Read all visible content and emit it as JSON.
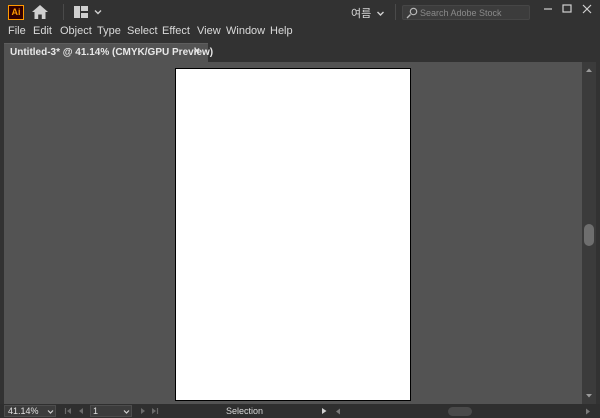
{
  "app": {
    "logo_text": "Ai",
    "language_label": "여름",
    "stock_search_placeholder": "Search Adobe Stock"
  },
  "menu": [
    "File",
    "Edit",
    "Object",
    "Type",
    "Select",
    "Effect",
    "View",
    "Window",
    "Help"
  ],
  "document_tab": {
    "label": "Untitled-3* @ 41.14% (CMYK/GPU Preview)",
    "close_glyph": "×"
  },
  "status_bar": {
    "zoom": "41.14%",
    "artboard_number": "1",
    "tool_label": "Selection"
  },
  "colors": {
    "chrome": "#323232",
    "canvas": "#535353",
    "artboard": "#ffffff",
    "ai_brand": "#ff9a00"
  },
  "icons": [
    "ai-logo",
    "home-icon",
    "workspace-switcher-icon",
    "chevron-down-icon",
    "search-icon",
    "minimize-icon",
    "maximize-icon",
    "close-icon",
    "first-page-icon",
    "prev-page-icon",
    "next-page-icon",
    "last-page-icon",
    "play-icon"
  ]
}
